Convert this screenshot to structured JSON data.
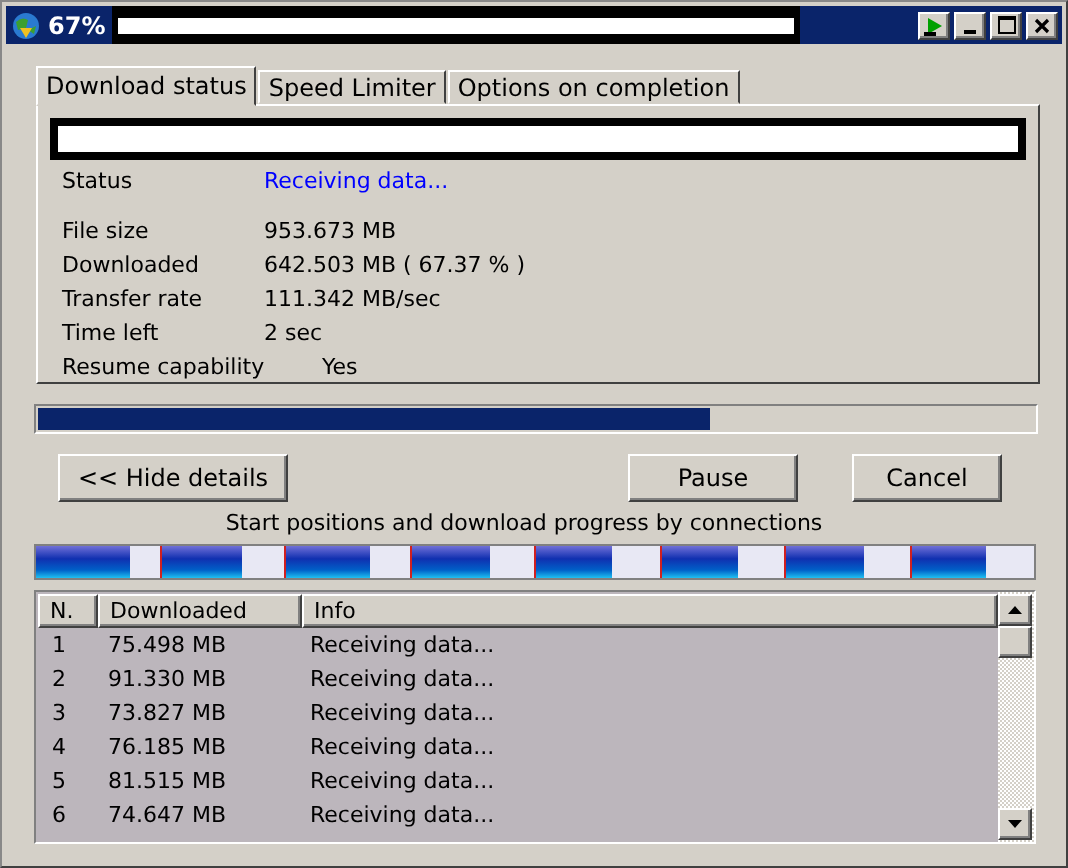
{
  "window": {
    "title": "67%"
  },
  "tabs": [
    {
      "label": "Download status",
      "selected": true
    },
    {
      "label": "Speed Limiter",
      "selected": false
    },
    {
      "label": "Options on completion",
      "selected": false
    }
  ],
  "status": {
    "label": "Status",
    "value": "Receiving data..."
  },
  "details": [
    {
      "label": "File size",
      "value": "953.673  MB"
    },
    {
      "label": "Downloaded",
      "value": "642.503  MB  ( 67.37 % )"
    },
    {
      "label": "Transfer rate",
      "value": "111.342  MB/sec"
    },
    {
      "label": "Time left",
      "value": "2 sec"
    },
    {
      "label": "Resume capability",
      "value": "Yes"
    }
  ],
  "progress": {
    "level": 0.6737
  },
  "buttons": [
    {
      "label": "<< Hide details"
    },
    {
      "label": "Pause"
    },
    {
      "label": "Cancel"
    }
  ],
  "connections_caption": "Start positions and download progress by connections",
  "connection_segments": [
    {
      "level": 0.76
    },
    {
      "level": 0.66
    },
    {
      "level": 0.69
    },
    {
      "level": 0.64
    },
    {
      "level": 0.61
    },
    {
      "level": 0.62
    },
    {
      "level": 0.63
    },
    {
      "level": 0.61
    }
  ],
  "table": {
    "columns": [
      "N.",
      "Downloaded",
      "Info"
    ],
    "rows": [
      [
        "1",
        "75.498  MB",
        "Receiving data..."
      ],
      [
        "2",
        "91.330  MB",
        "Receiving data..."
      ],
      [
        "3",
        "73.827  MB",
        "Receiving data..."
      ],
      [
        "4",
        "76.185  MB",
        "Receiving data..."
      ],
      [
        "5",
        "81.515  MB",
        "Receiving data..."
      ],
      [
        "6",
        "74.647  MB",
        "Receiving data..."
      ]
    ]
  }
}
